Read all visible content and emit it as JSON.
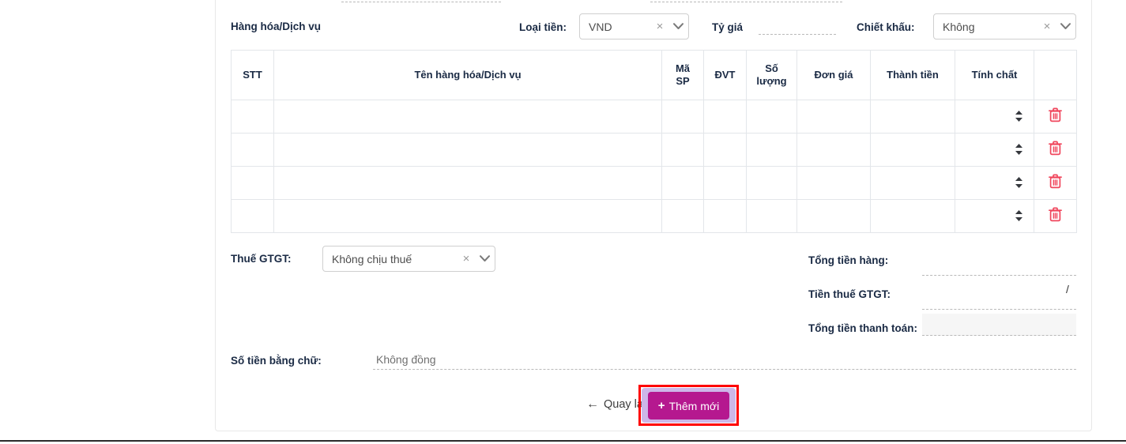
{
  "section": {
    "title": "Hàng hóa/Dịch vụ"
  },
  "fields": {
    "loai_tien": {
      "label": "Loại tiền:",
      "value": "VND",
      "clear": "×"
    },
    "ty_gia": {
      "label": "Tỷ giá",
      "value": ""
    },
    "chiet_khau": {
      "label": "Chiết khấu:",
      "value": "Không",
      "clear": "×"
    },
    "thue_gtgt": {
      "label": "Thuế GTGT:",
      "value": "Không chịu thuế",
      "clear": "×"
    }
  },
  "table": {
    "columns": [
      {
        "key": "stt",
        "label": "STT"
      },
      {
        "key": "ten",
        "label": "Tên hàng hóa/Dịch vụ"
      },
      {
        "key": "masp",
        "label": "Mã\nSP"
      },
      {
        "key": "dvt",
        "label": "ĐVT"
      },
      {
        "key": "soluong",
        "label": "Số\nlượng"
      },
      {
        "key": "dongia",
        "label": "Đơn giá"
      },
      {
        "key": "thanhtien",
        "label": "Thành tiền"
      },
      {
        "key": "tinhchat",
        "label": "Tính chất"
      },
      {
        "key": "actions",
        "label": ""
      }
    ],
    "rows": [
      {
        "stt": "",
        "ten": "",
        "masp": "",
        "dvt": "",
        "soluong": "",
        "dongia": "",
        "thanhtien": "",
        "tinhchat": ""
      },
      {
        "stt": "",
        "ten": "",
        "masp": "",
        "dvt": "",
        "soluong": "",
        "dongia": "",
        "thanhtien": "",
        "tinhchat": ""
      },
      {
        "stt": "",
        "ten": "",
        "masp": "",
        "dvt": "",
        "soluong": "",
        "dongia": "",
        "thanhtien": "",
        "tinhchat": ""
      },
      {
        "stt": "",
        "ten": "",
        "masp": "",
        "dvt": "",
        "soluong": "",
        "dongia": "",
        "thanhtien": "",
        "tinhchat": ""
      }
    ],
    "row_icons": {
      "sort": "sort-updown-icon",
      "delete": "trash-icon"
    }
  },
  "totals": [
    {
      "label": "Tổng tiền hàng:",
      "value": ""
    },
    {
      "label": "Tiền thuế GTGT:",
      "value": "",
      "suffix": "/"
    },
    {
      "label": "Tổng tiền thanh toán:",
      "value": ""
    }
  ],
  "amount_in_words": {
    "label": "Số tiền bằng chữ:",
    "value": "Không đồng"
  },
  "footer": {
    "back_label": "Quay lại",
    "back_icon": "arrow-left-icon",
    "add_label": "Thêm mới",
    "add_icon": "plus-icon"
  },
  "colors": {
    "accent": "#b5188f",
    "focus_ring": "#cdb7e8",
    "annotation": "#ff0000",
    "trash": "#f0465c",
    "label_text": "#1a2a44",
    "border": "#e3e6ea"
  }
}
